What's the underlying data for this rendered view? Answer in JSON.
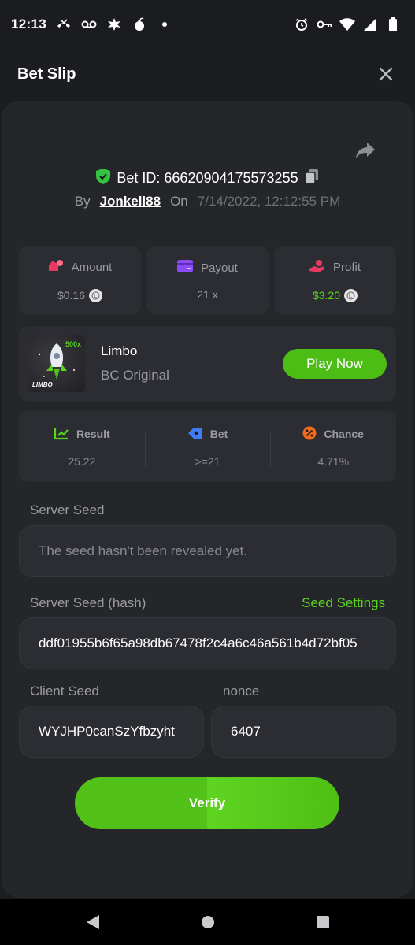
{
  "status_bar": {
    "time": "12:13"
  },
  "header": {
    "title": "Bet Slip"
  },
  "bet": {
    "id_label": "Bet ID: 66620904175573255",
    "by_label": "By",
    "username": "Jonkell88",
    "on_label": "On",
    "datetime": "7/14/2022, 12:12:55 PM"
  },
  "stats": [
    {
      "label": "Amount",
      "value": "$0.16"
    },
    {
      "label": "Payout",
      "value": "21 x"
    },
    {
      "label": "Profit",
      "value": "$3.20"
    }
  ],
  "game": {
    "name": "Limbo",
    "subtitle": "BC Original",
    "play_label": "Play Now",
    "thumb_badge": "500x",
    "thumb_label": "LIMBO"
  },
  "results": [
    {
      "label": "Result",
      "value": "25.22"
    },
    {
      "label": "Bet",
      "value": ">=21"
    },
    {
      "label": "Chance",
      "value": "4.71%"
    }
  ],
  "server_seed": {
    "label": "Server Seed",
    "placeholder": "The seed hasn't been revealed yet."
  },
  "server_seed_hash": {
    "label": "Server Seed (hash)",
    "settings_link": "Seed Settings",
    "value": "ddf01955b6f65a98db67478f2c4a6c46a561b4d72bf05"
  },
  "client_seed": {
    "label": "Client Seed",
    "value": "WYJHP0canSzYfbzyht"
  },
  "nonce": {
    "label": "nonce",
    "value": "6407"
  },
  "verify_label": "Verify",
  "colors": {
    "accent_green": "#5ad41d",
    "button_green": "#4bbd15",
    "background": "#1c1d20",
    "sheet": "#25262a",
    "card": "#2c2d32"
  }
}
